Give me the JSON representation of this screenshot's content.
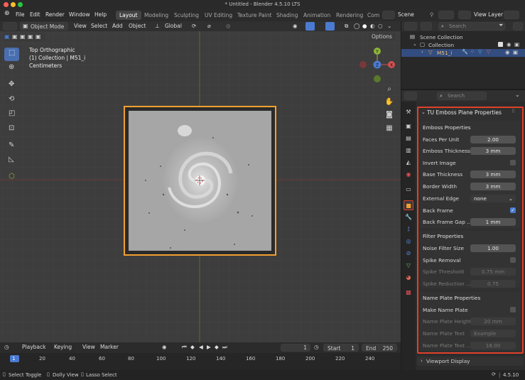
{
  "window": {
    "title": "* Untitled - Blender 4.5.10 LTS"
  },
  "menubar": {
    "items": [
      "File",
      "Edit",
      "Render",
      "Window",
      "Help"
    ],
    "workspaces": [
      "Layout",
      "Modeling",
      "Sculpting",
      "UV Editing",
      "Texture Paint",
      "Shading",
      "Animation",
      "Rendering",
      "Com"
    ],
    "scene_label": "Scene",
    "view_layer_label": "View Layer"
  },
  "viewport_header": {
    "mode": "Object Mode",
    "menus": [
      "View",
      "Select",
      "Add",
      "Object"
    ],
    "transform": "Global",
    "options": "Options"
  },
  "viewport": {
    "view_name": "Top Orthographic",
    "collection_info": "(1) Collection | M51_i",
    "units": "Centimeters",
    "gizmo": {
      "y": "Y",
      "x": "X",
      "z": "Z"
    }
  },
  "outliner": {
    "search_placeholder": "Search",
    "items": [
      {
        "label": "Scene Collection"
      },
      {
        "label": "Collection"
      },
      {
        "label": "M51_i"
      }
    ]
  },
  "properties": {
    "search_placeholder": "Search",
    "panel_title": "TU Emboss Plane Properties",
    "emboss": {
      "title": "Emboss Properties",
      "rows": [
        {
          "label": "Faces Per Unit",
          "value": "2.00"
        },
        {
          "label": "Emboss Thickness",
          "value": "3 mm"
        },
        {
          "label": "Invert Image",
          "checked": false
        },
        {
          "label": "Base Thickness",
          "value": "3 mm"
        },
        {
          "label": "Border Width",
          "value": "3 mm"
        },
        {
          "label": "External Edge",
          "value": "none"
        },
        {
          "label": "Back Frame",
          "checked": true
        },
        {
          "label": "Back Frame Gap ...",
          "value": "1 mm"
        }
      ]
    },
    "filter": {
      "title": "Filter Properties",
      "rows": [
        {
          "label": "Noise Filter Size",
          "value": "1.00"
        },
        {
          "label": "Spike Removal",
          "checked": false
        },
        {
          "label": "Spike Threshold",
          "value": "0.75 mm"
        },
        {
          "label": "Spike Reduction ...",
          "value": "0.75"
        }
      ]
    },
    "nameplate": {
      "title": "Name Plate Properties",
      "rows": [
        {
          "label": "Make Name Plate",
          "checked": false
        },
        {
          "label": "Name Plate Height",
          "value": "20 mm"
        },
        {
          "label": "Name Plate Text",
          "value": "Example"
        },
        {
          "label": "Name Plate Text ...",
          "value": "18.00"
        }
      ]
    },
    "viewport_display": "Viewport Display"
  },
  "timeline": {
    "menus": [
      "Playback",
      "Keying",
      "View",
      "Marker"
    ],
    "current_frame": "1",
    "start_label": "Start",
    "start": "1",
    "end_label": "End",
    "end": "250",
    "ticks": [
      "1",
      "20",
      "40",
      "60",
      "80",
      "100",
      "120",
      "140",
      "160",
      "180",
      "200",
      "220",
      "240"
    ]
  },
  "statusbar": {
    "select": "Select Toggle",
    "dolly": "Dolly View",
    "lasso": "Lasso Select",
    "version": "4.5.10"
  },
  "colors": {
    "accent": "#4a7bd0",
    "highlight_border": "#e0402a",
    "selection_orange": "#f0a030"
  }
}
